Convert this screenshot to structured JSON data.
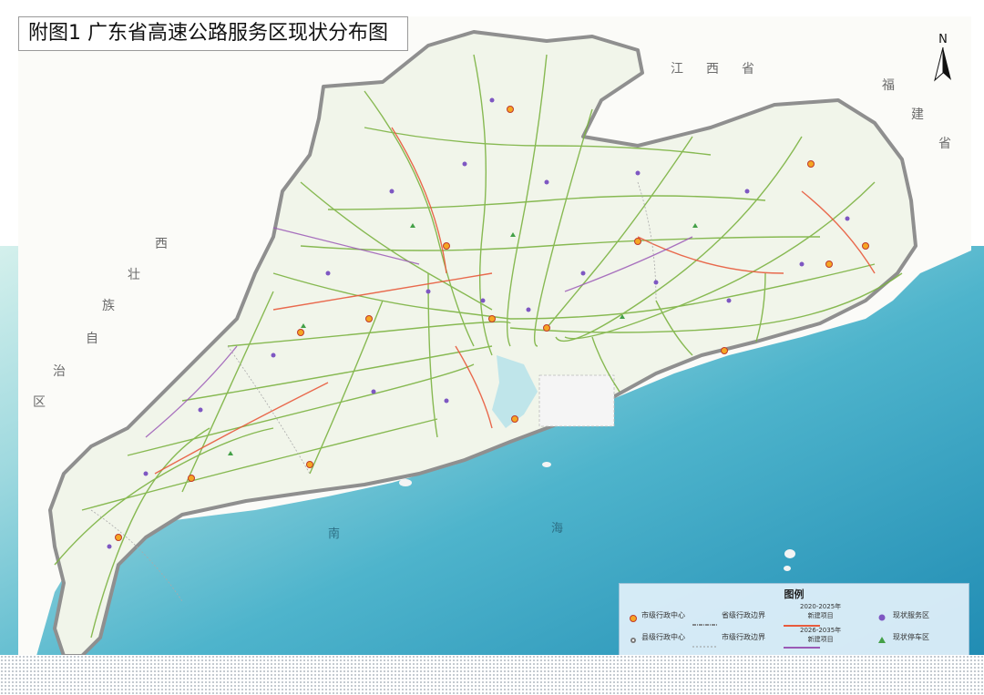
{
  "title": "附图1  广东省高速公路服务区现状分布图",
  "north_label": "N",
  "province_labels": {
    "jiangxi": [
      "江",
      "西",
      "省"
    ],
    "fujian": [
      "福",
      "建",
      "省"
    ],
    "guangxi": [
      "西",
      "壮",
      "族",
      "自",
      "治",
      "区"
    ]
  },
  "sea_labels": [
    "南",
    "海"
  ],
  "map_colors": {
    "land": "#f3f6ee",
    "outside_land": "#fbfbf8",
    "sea_deep": "#1f93b8",
    "sea_shallow": "#bfe7e8",
    "expressway": "#7cb342",
    "planned_2025": "#e85a3c",
    "planned_2035": "#9b59b6",
    "boundary": "#8f8f8f"
  },
  "legend": {
    "title": "图例",
    "items": [
      {
        "symbol": "city-center-icon",
        "label": "市级行政中心"
      },
      {
        "symbol": "provincial-boundary",
        "label": "省级行政边界"
      },
      {
        "symbol": "planned-2025-line",
        "label": "2020-2025年\n新建项目"
      },
      {
        "symbol": "service-area-icon",
        "label": "现状服务区"
      },
      {
        "symbol": "county-center-icon",
        "label": "县级行政中心"
      },
      {
        "symbol": "city-boundary",
        "label": "市级行政边界"
      },
      {
        "symbol": "planned-2035-line",
        "label": "2026-2035年\n新建项目"
      },
      {
        "symbol": "rest-stop-icon",
        "label": "现状停车区"
      }
    ]
  }
}
